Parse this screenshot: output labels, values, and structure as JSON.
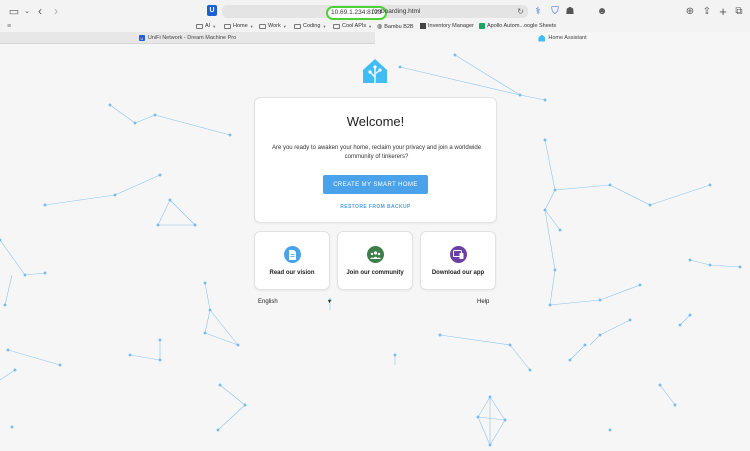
{
  "browser": {
    "url_host": "10.69.1.234:8123",
    "url_path": "/onboarding.html",
    "bookmarks": [
      {
        "label": "AI",
        "type": "folder"
      },
      {
        "label": "Home",
        "type": "folder"
      },
      {
        "label": "Work",
        "type": "folder"
      },
      {
        "label": "Coding",
        "type": "folder"
      },
      {
        "label": "Cool APIs",
        "type": "folder"
      },
      {
        "label": "Bambu B2B",
        "type": "link"
      },
      {
        "label": "Inventory Manager",
        "type": "link"
      },
      {
        "label": "Apollo Autom...oogle Sheets",
        "type": "link"
      }
    ],
    "tabs": [
      {
        "label": "UniFi Network - Dream Machine Pro",
        "active": false
      },
      {
        "label": "Home Assistant",
        "active": true
      }
    ]
  },
  "onboarding": {
    "title": "Welcome!",
    "intro": "Are you ready to awaken your home, reclaim your privacy and join a worldwide community of tinkerers?",
    "create_button": "CREATE MY SMART HOME",
    "restore_link": "RESTORE FROM BACKUP",
    "cards": [
      {
        "label": "Read our vision",
        "icon": "document-icon",
        "color": "#4aa3ea"
      },
      {
        "label": "Join our community",
        "icon": "people-icon",
        "color": "#3e7e4a"
      },
      {
        "label": "Download our app",
        "icon": "devices-icon",
        "color": "#6b3fa3"
      }
    ],
    "language": "English",
    "help": "Help"
  },
  "colors": {
    "accent": "#4aa3ea",
    "url_highlight": "#4cd137",
    "network_lines": "#8cc4ee"
  }
}
